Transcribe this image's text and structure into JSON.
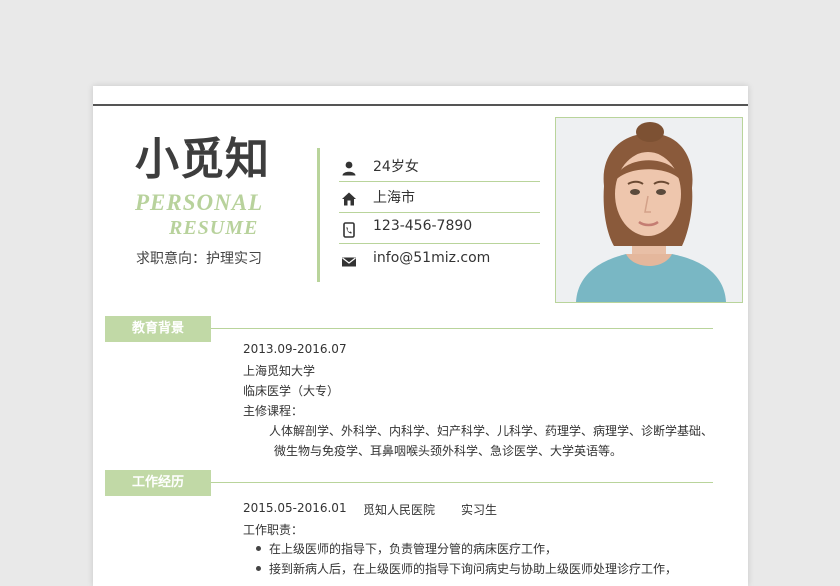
{
  "header": {
    "name": "小觅知",
    "personal": "PERSONAL",
    "resume": "RESUME",
    "objective": "求职意向：护理实习"
  },
  "contact": [
    {
      "icon": "person-icon",
      "text": "24岁女"
    },
    {
      "icon": "home-icon",
      "text": "上海市"
    },
    {
      "icon": "phone-icon",
      "text": "123-456-7890"
    },
    {
      "icon": "mail-icon",
      "text": "info@51miz.com"
    }
  ],
  "education": {
    "title": "教育背景",
    "period": "2013.09-2016.07",
    "school": "上海觅知大学",
    "major": "临床医学（大专）",
    "courses_label": "主修课程：",
    "courses_line1": "人体解剖学、外科学、内科学、妇产科学、儿科学、药理学、病理学、诊断学基础、",
    "courses_line2": "微生物与免疫学、耳鼻咽喉头颈外科学、急诊医学、大学英语等。"
  },
  "work": {
    "title": "工作经历",
    "period": "2015.05-2016.01",
    "company": "觅知人民医院",
    "position": "实习生",
    "duties_label": "工作职责：",
    "duties": [
      "在上级医师的指导下，负责管理分管的病床医疗工作，",
      "接到新病人后，在上级医师的指导下询问病史与协助上级医师处理诊疗工作，"
    ]
  },
  "colors": {
    "accent": "#b9d49b",
    "section_bg": "#c1d9a6"
  }
}
